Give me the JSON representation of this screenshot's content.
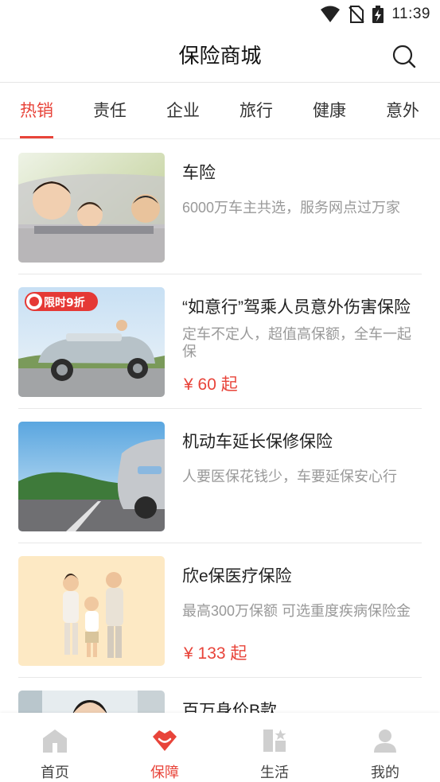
{
  "status_bar": {
    "time": "11:39"
  },
  "header": {
    "title": "保险商城"
  },
  "tabs": [
    {
      "label": "热销",
      "active": true
    },
    {
      "label": "责任"
    },
    {
      "label": "企业"
    },
    {
      "label": "旅行"
    },
    {
      "label": "健康"
    },
    {
      "label": "意外"
    }
  ],
  "products": [
    {
      "title": "车险",
      "desc": "6000万车主共选，服务网点过万家",
      "price": ""
    },
    {
      "title": "“如意行”驾乘人员意外伤害保险",
      "desc": "定车不定人，超值高保额，全车一起保",
      "price": "¥ 60 起",
      "badge": "限时9折"
    },
    {
      "title": "机动车延长保修保险",
      "desc": "人要医保花钱少，车要延保安心行",
      "price": ""
    },
    {
      "title": "欣e保医疗保险",
      "desc": "最高300万保额 可选重度疾病保险金",
      "price": "¥ 133 起"
    },
    {
      "title": "百万身价B款",
      "desc": "",
      "price": ""
    }
  ],
  "bottom_nav": [
    {
      "label": "首页",
      "icon": "home-icon"
    },
    {
      "label": "保障",
      "icon": "shield-lips-icon",
      "active": true
    },
    {
      "label": "生活",
      "icon": "life-grid-icon"
    },
    {
      "label": "我的",
      "icon": "user-icon"
    }
  ],
  "colors": {
    "accent": "#e8443a",
    "text": "#222222",
    "muted": "#999999"
  }
}
